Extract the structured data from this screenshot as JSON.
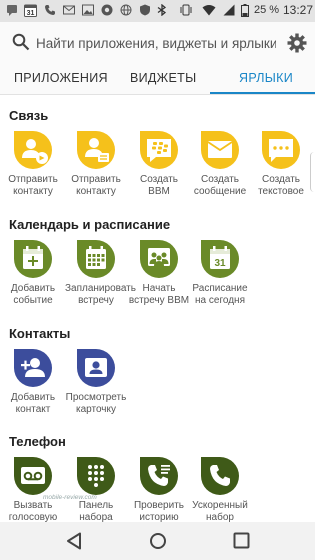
{
  "status": {
    "battery": "25 %",
    "time": "13:27",
    "calendar_day": "31"
  },
  "search": {
    "placeholder": "Найти приложения, виджеты и ярлыки"
  },
  "tabs": [
    {
      "label": "ПРИЛОЖЕНИЯ"
    },
    {
      "label": "ВИДЖЕТЫ"
    },
    {
      "label": "ЯРЛЫКИ"
    }
  ],
  "sections": [
    {
      "title": "Связь",
      "items": [
        {
          "label": "Отправить контакту",
          "icon": "send-contact-icon",
          "color": "#f5c11b"
        },
        {
          "label": "Отправить контакту",
          "icon": "send-contact-card-icon",
          "color": "#f5c11b"
        },
        {
          "label": "Создать BBM",
          "icon": "bbm-icon",
          "color": "#f5c11b"
        },
        {
          "label": "Создать сообщение",
          "icon": "email-icon",
          "color": "#f5c11b"
        },
        {
          "label": "Создать текстовое",
          "icon": "text-message-icon",
          "color": "#f5c11b"
        }
      ]
    },
    {
      "title": "Календарь и расписание",
      "items": [
        {
          "label": "Добавить событие",
          "icon": "add-event-icon",
          "color": "#6a8a28"
        },
        {
          "label": "Запланировать встречу",
          "icon": "schedule-meeting-icon",
          "color": "#6a8a28"
        },
        {
          "label": "Начать встречу BBM",
          "icon": "bbm-meeting-icon",
          "color": "#6a8a28"
        },
        {
          "label": "Расписание на сегодня",
          "icon": "today-schedule-icon",
          "color": "#6a8a28",
          "day": "31"
        }
      ]
    },
    {
      "title": "Контакты",
      "items": [
        {
          "label": "Добавить контакт",
          "icon": "add-contact-icon",
          "color": "#3c4d9c"
        },
        {
          "label": "Просмотреть карточку",
          "icon": "view-card-icon",
          "color": "#3c4d9c"
        }
      ]
    },
    {
      "title": "Телефон",
      "items": [
        {
          "label": "Вызвать голосовую",
          "icon": "voicemail-icon",
          "color": "#3f5a18"
        },
        {
          "label": "Панель набора",
          "icon": "dialpad-icon",
          "color": "#3f5a18"
        },
        {
          "label": "Проверить историю",
          "icon": "call-history-icon",
          "color": "#3f5a18"
        },
        {
          "label": "Ускоренный набор",
          "icon": "speed-dial-icon",
          "color": "#3f5a18"
        }
      ]
    }
  ],
  "watermark": "mobile-review.com"
}
